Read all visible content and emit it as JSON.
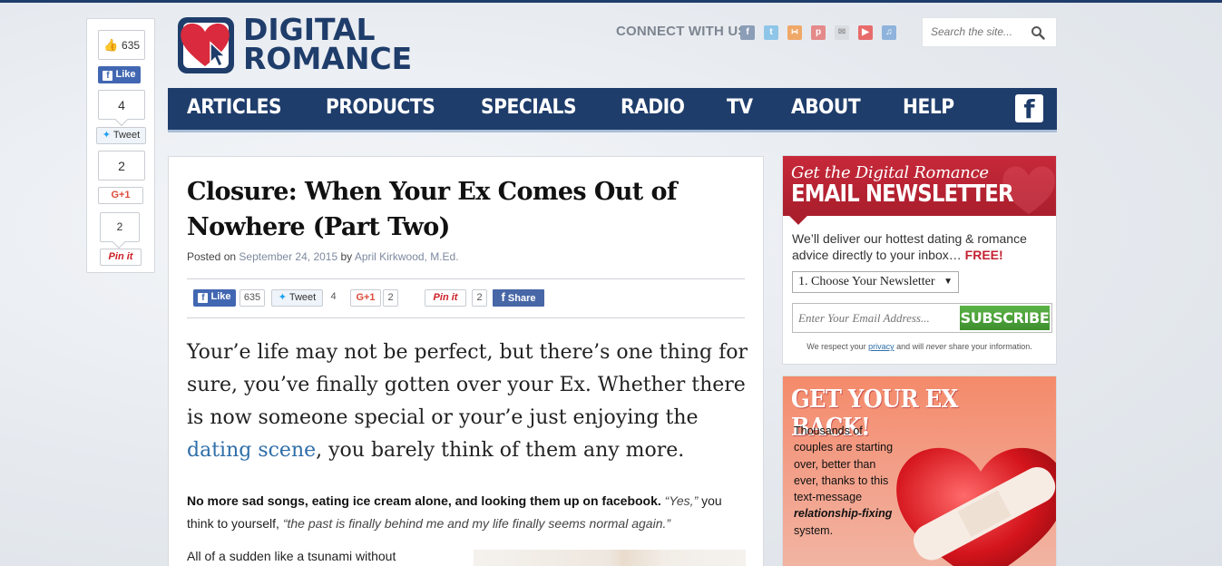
{
  "brand": {
    "name_line1": "DIGITAL",
    "name_line2": "ROMANCE",
    "colors": {
      "navy": "#1f3d6b",
      "red": "#c7293a",
      "green": "#4aa03a"
    }
  },
  "header": {
    "connect_label": "CONNECT WITH US",
    "social_icons": [
      "facebook-icon",
      "twitter-icon",
      "rss-icon",
      "pinterest-icon",
      "email-icon",
      "youtube-icon",
      "itunes-icon"
    ],
    "search_placeholder": "Search the site..."
  },
  "nav": {
    "items": [
      "ARTICLES",
      "PRODUCTS",
      "SPECIALS",
      "RADIO",
      "TV",
      "ABOUT",
      "HELP"
    ],
    "fb_glyph": "f"
  },
  "share_sidebar": {
    "fb_count": "635",
    "fb_label": "Like",
    "tweet_count": "4",
    "tweet_label": "Tweet",
    "gplus_count": "2",
    "gplus_label": "G+1",
    "pin_count": "2",
    "pin_label": "Pin it"
  },
  "article": {
    "title": "Closure: When Your Ex Comes Out of Nowhere (Part Two)",
    "posted_on": "Posted on",
    "date": "September 24, 2015",
    "by": "by",
    "author": "April Kirkwood, M.Ed.",
    "share_row": {
      "like_label": "Like",
      "like_count": "635",
      "tweet_label": "Tweet",
      "tweet_count": "4",
      "gplus_label": "G+1",
      "gplus_count": "2",
      "pin_label": "Pin it",
      "pin_count": "2",
      "share_label": "Share"
    },
    "lead_before": "Your’e life may not be perfect, but there’s one thing for sure, you’ve finally gotten over your Ex. Whether there is now someone special or your’e just enjoying the ",
    "lead_link": "dating scene",
    "lead_after": ", you barely think of them any more.",
    "p1_bold": "No more sad songs, eating ice cream alone, and looking them up on facebook.",
    "p1_italic1": "“Yes,”",
    "p1_mid": " you think to yourself, ",
    "p1_italic2": "“the past is finally behind me and my life finally seems normal again.”",
    "p2": "All of a sudden like a tsunami without"
  },
  "newsletter": {
    "pre": "Get the Digital Romance",
    "main": "EMAIL NEWSLETTER",
    "desc": "We’ll deliver our hottest dating & romance advice directly to your inbox…",
    "free": "FREE!",
    "select_value": "1. Choose Your Newsletter",
    "email_placeholder": "Enter Your Email Address...",
    "subscribe": "SUBSCRIBE",
    "privacy_pre": "We respect your",
    "privacy_link": "privacy",
    "privacy_mid": "and will",
    "privacy_never": "never",
    "privacy_post": "share your information."
  },
  "ad": {
    "title": "GET YOUR EX BACK!",
    "copy_before": "Thousands of couples are starting over, better than ever, thanks to this text-message",
    "copy_bold": "relationship-fixing",
    "copy_after": "system."
  }
}
